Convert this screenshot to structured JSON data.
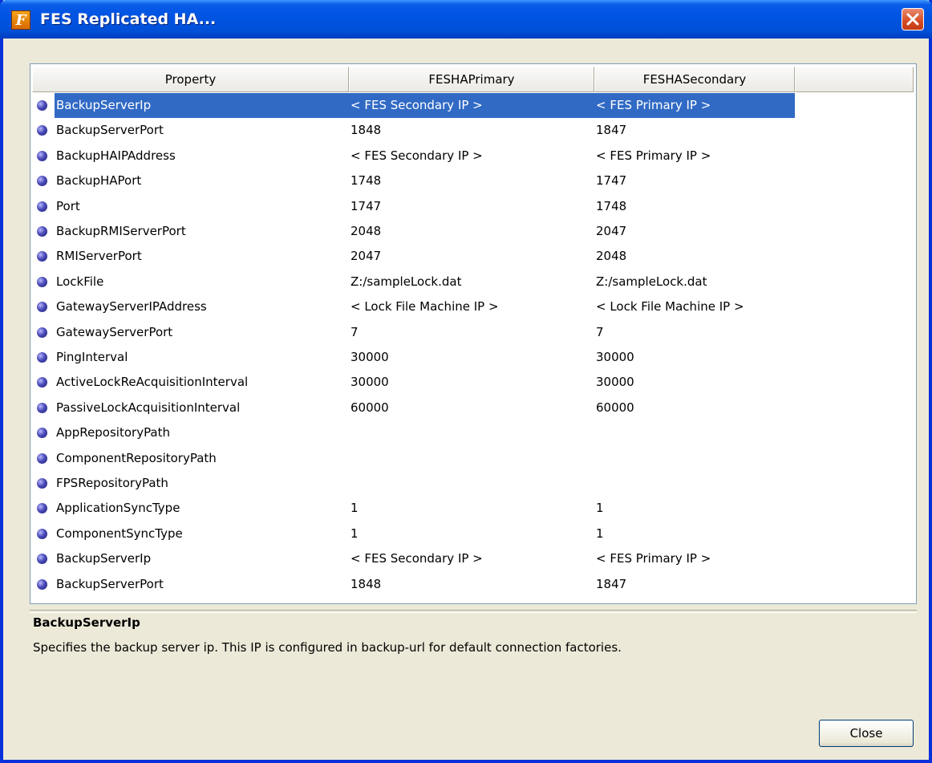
{
  "window": {
    "title": "FES Replicated HA...",
    "app_icon_letter": "F"
  },
  "table": {
    "columns": [
      "Property",
      "FESHAPrimary",
      "FESHASecondary"
    ],
    "selected_row": 0,
    "rows": [
      {
        "property": "BackupServerIp",
        "primary": "< FES Secondary IP >",
        "secondary": "< FES Primary IP >"
      },
      {
        "property": "BackupServerPort",
        "primary": "1848",
        "secondary": "1847"
      },
      {
        "property": "BackupHAIPAddress",
        "primary": "< FES Secondary IP >",
        "secondary": "< FES Primary IP >"
      },
      {
        "property": "BackupHAPort",
        "primary": "1748",
        "secondary": "1747"
      },
      {
        "property": "Port",
        "primary": "1747",
        "secondary": "1748"
      },
      {
        "property": "BackupRMIServerPort",
        "primary": "2048",
        "secondary": "2047"
      },
      {
        "property": "RMIServerPort",
        "primary": "2047",
        "secondary": "2048"
      },
      {
        "property": "LockFile",
        "primary": "Z:/sampleLock.dat",
        "secondary": "Z:/sampleLock.dat"
      },
      {
        "property": "GatewayServerIPAddress",
        "primary": "< Lock File Machine IP >",
        "secondary": "< Lock File Machine IP >"
      },
      {
        "property": "GatewayServerPort",
        "primary": "7",
        "secondary": "7"
      },
      {
        "property": "PingInterval",
        "primary": "30000",
        "secondary": "30000"
      },
      {
        "property": "ActiveLockReAcquisitionInterval",
        "primary": "30000",
        "secondary": "30000"
      },
      {
        "property": "PassiveLockAcquisitionInterval",
        "primary": "60000",
        "secondary": "60000"
      },
      {
        "property": "AppRepositoryPath",
        "primary": "",
        "secondary": ""
      },
      {
        "property": "ComponentRepositoryPath",
        "primary": "",
        "secondary": ""
      },
      {
        "property": "FPSRepositoryPath",
        "primary": "",
        "secondary": ""
      },
      {
        "property": "ApplicationSyncType",
        "primary": "1",
        "secondary": "1"
      },
      {
        "property": "ComponentSyncType",
        "primary": "1",
        "secondary": "1"
      },
      {
        "property": "BackupServerIp",
        "primary": "< FES Secondary IP >",
        "secondary": "< FES Primary IP >"
      },
      {
        "property": "BackupServerPort",
        "primary": "1848",
        "secondary": "1847"
      }
    ]
  },
  "description": {
    "title": "BackupServerIp",
    "text": "Specifies the backup server ip. This IP is configured in backup-url for default connection factories."
  },
  "buttons": {
    "close_label": "Close"
  },
  "colors": {
    "selection": "#316ac5",
    "titlebar": "#0054e3",
    "dialog_bg": "#ece9d8"
  }
}
